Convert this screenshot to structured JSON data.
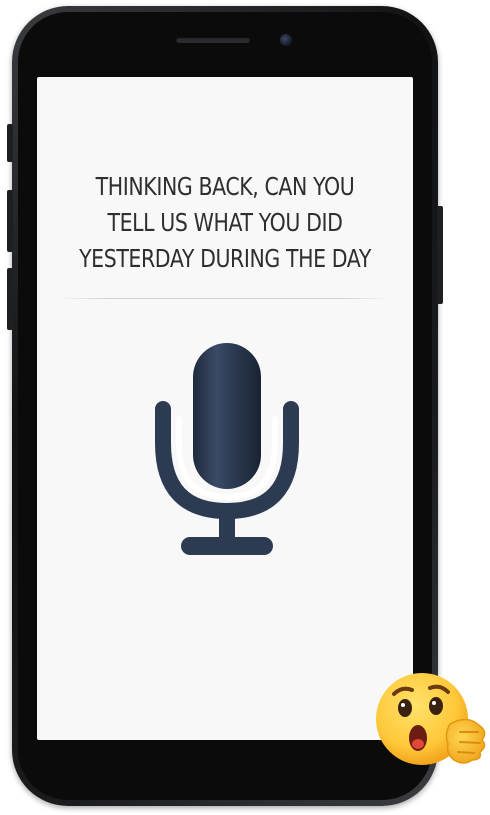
{
  "screen": {
    "question_lines": [
      "THINKING BACK, CAN YOU",
      "TELL US WHAT YOU DID",
      "YESTERDAY DURING THE DAY"
    ]
  },
  "icons": {
    "microphone": "microphone-icon",
    "emoji": "surprised-face-emoji"
  },
  "colors": {
    "mic": "#2c3a52",
    "screen_bg": "#f8f8f8",
    "text": "#2f2f2f",
    "phone_body": "#111214"
  }
}
